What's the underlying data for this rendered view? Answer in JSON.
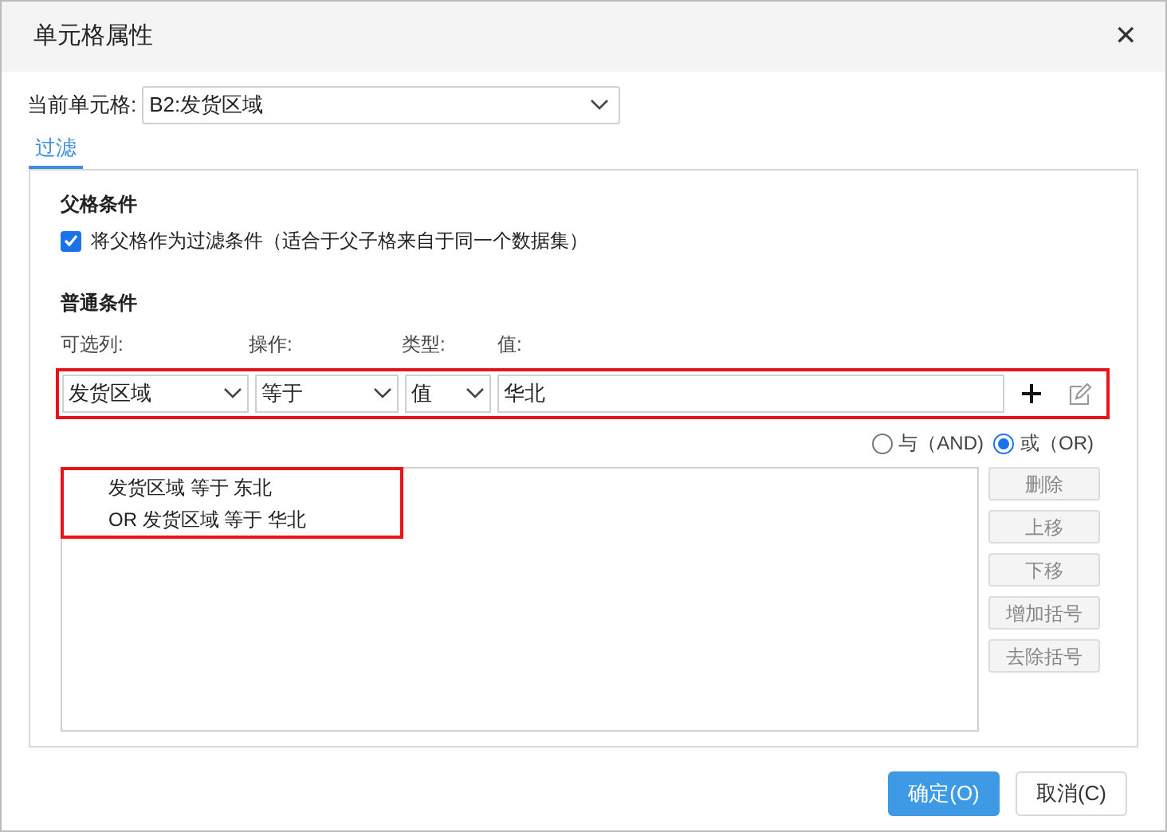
{
  "window": {
    "title": "单元格属性",
    "close": "✕"
  },
  "current_cell": {
    "label": "当前单元格:",
    "value": "B2:发货区域"
  },
  "tabs": [
    {
      "label": "过滤",
      "selected": true
    }
  ],
  "parent_condition": {
    "heading": "父格条件",
    "checkbox": {
      "label": "将父格作为过滤条件（适合于父子格来自于同一个数据集）",
      "checked": true
    }
  },
  "normal_condition": {
    "heading": "普通条件",
    "column_labels": [
      "可选列:",
      "操作:",
      "类型:",
      "值:"
    ],
    "column_select": "发货区域",
    "operator_select": "等于",
    "type_select": "值",
    "value": "华北",
    "logic": [
      {
        "label": "与（AND)",
        "selected": false
      },
      {
        "label": "或（OR)",
        "selected": true
      }
    ],
    "conditions": [
      "发货区域 等于 东北",
      "OR 发货区域 等于 华北"
    ],
    "side_buttons": [
      {
        "label": "删除",
        "disabled": true
      },
      {
        "label": "上移",
        "disabled": true
      },
      {
        "label": "下移",
        "disabled": true
      },
      {
        "label": "增加括号",
        "disabled": true
      },
      {
        "label": "去除括号",
        "disabled": true
      }
    ]
  },
  "buttons": [
    {
      "label": "确定(O)",
      "kind": "primary"
    },
    {
      "label": "取消(C)",
      "kind": "secondary"
    }
  ]
}
